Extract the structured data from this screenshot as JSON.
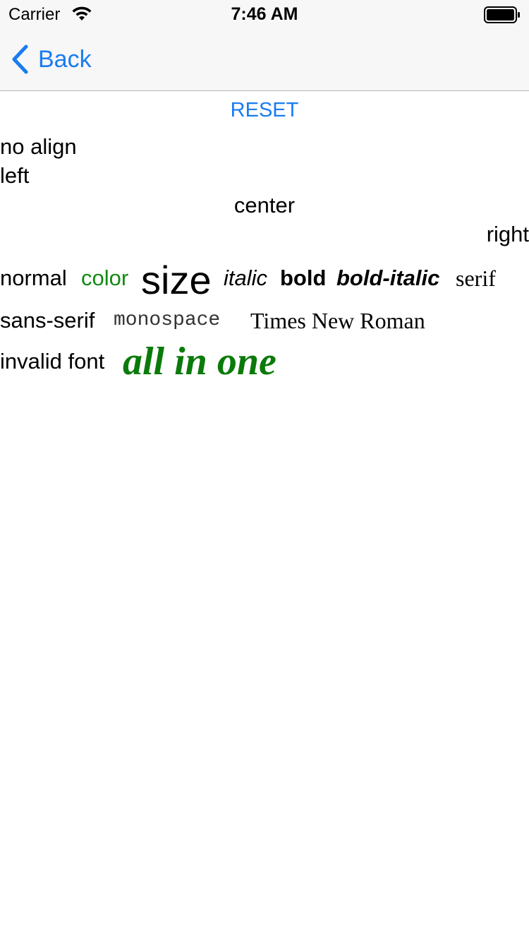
{
  "status_bar": {
    "carrier": "Carrier",
    "time": "7:46 AM",
    "wifi_icon": "wifi-icon",
    "battery_icon": "battery-icon"
  },
  "nav": {
    "back_label": "Back",
    "back_icon": "chevron-left-icon",
    "accent_color": "#1a7cf0"
  },
  "content": {
    "reset_label": "RESET",
    "align_lines": {
      "no_align": "no align",
      "left": "left",
      "center": "center",
      "right": "right"
    },
    "styles_row": {
      "normal": "normal",
      "color": "color",
      "size": "size",
      "italic": "italic",
      "bold": "bold",
      "bold_italic": "bold-italic",
      "serif": "serif"
    },
    "fonts_row": {
      "sans_serif": "sans-serif",
      "monospace": "monospace",
      "times_new_roman": "Times New Roman"
    },
    "last_row": {
      "invalid_font": "invalid font",
      "all_in_one": "all in one"
    },
    "green_color": "#118a11"
  }
}
